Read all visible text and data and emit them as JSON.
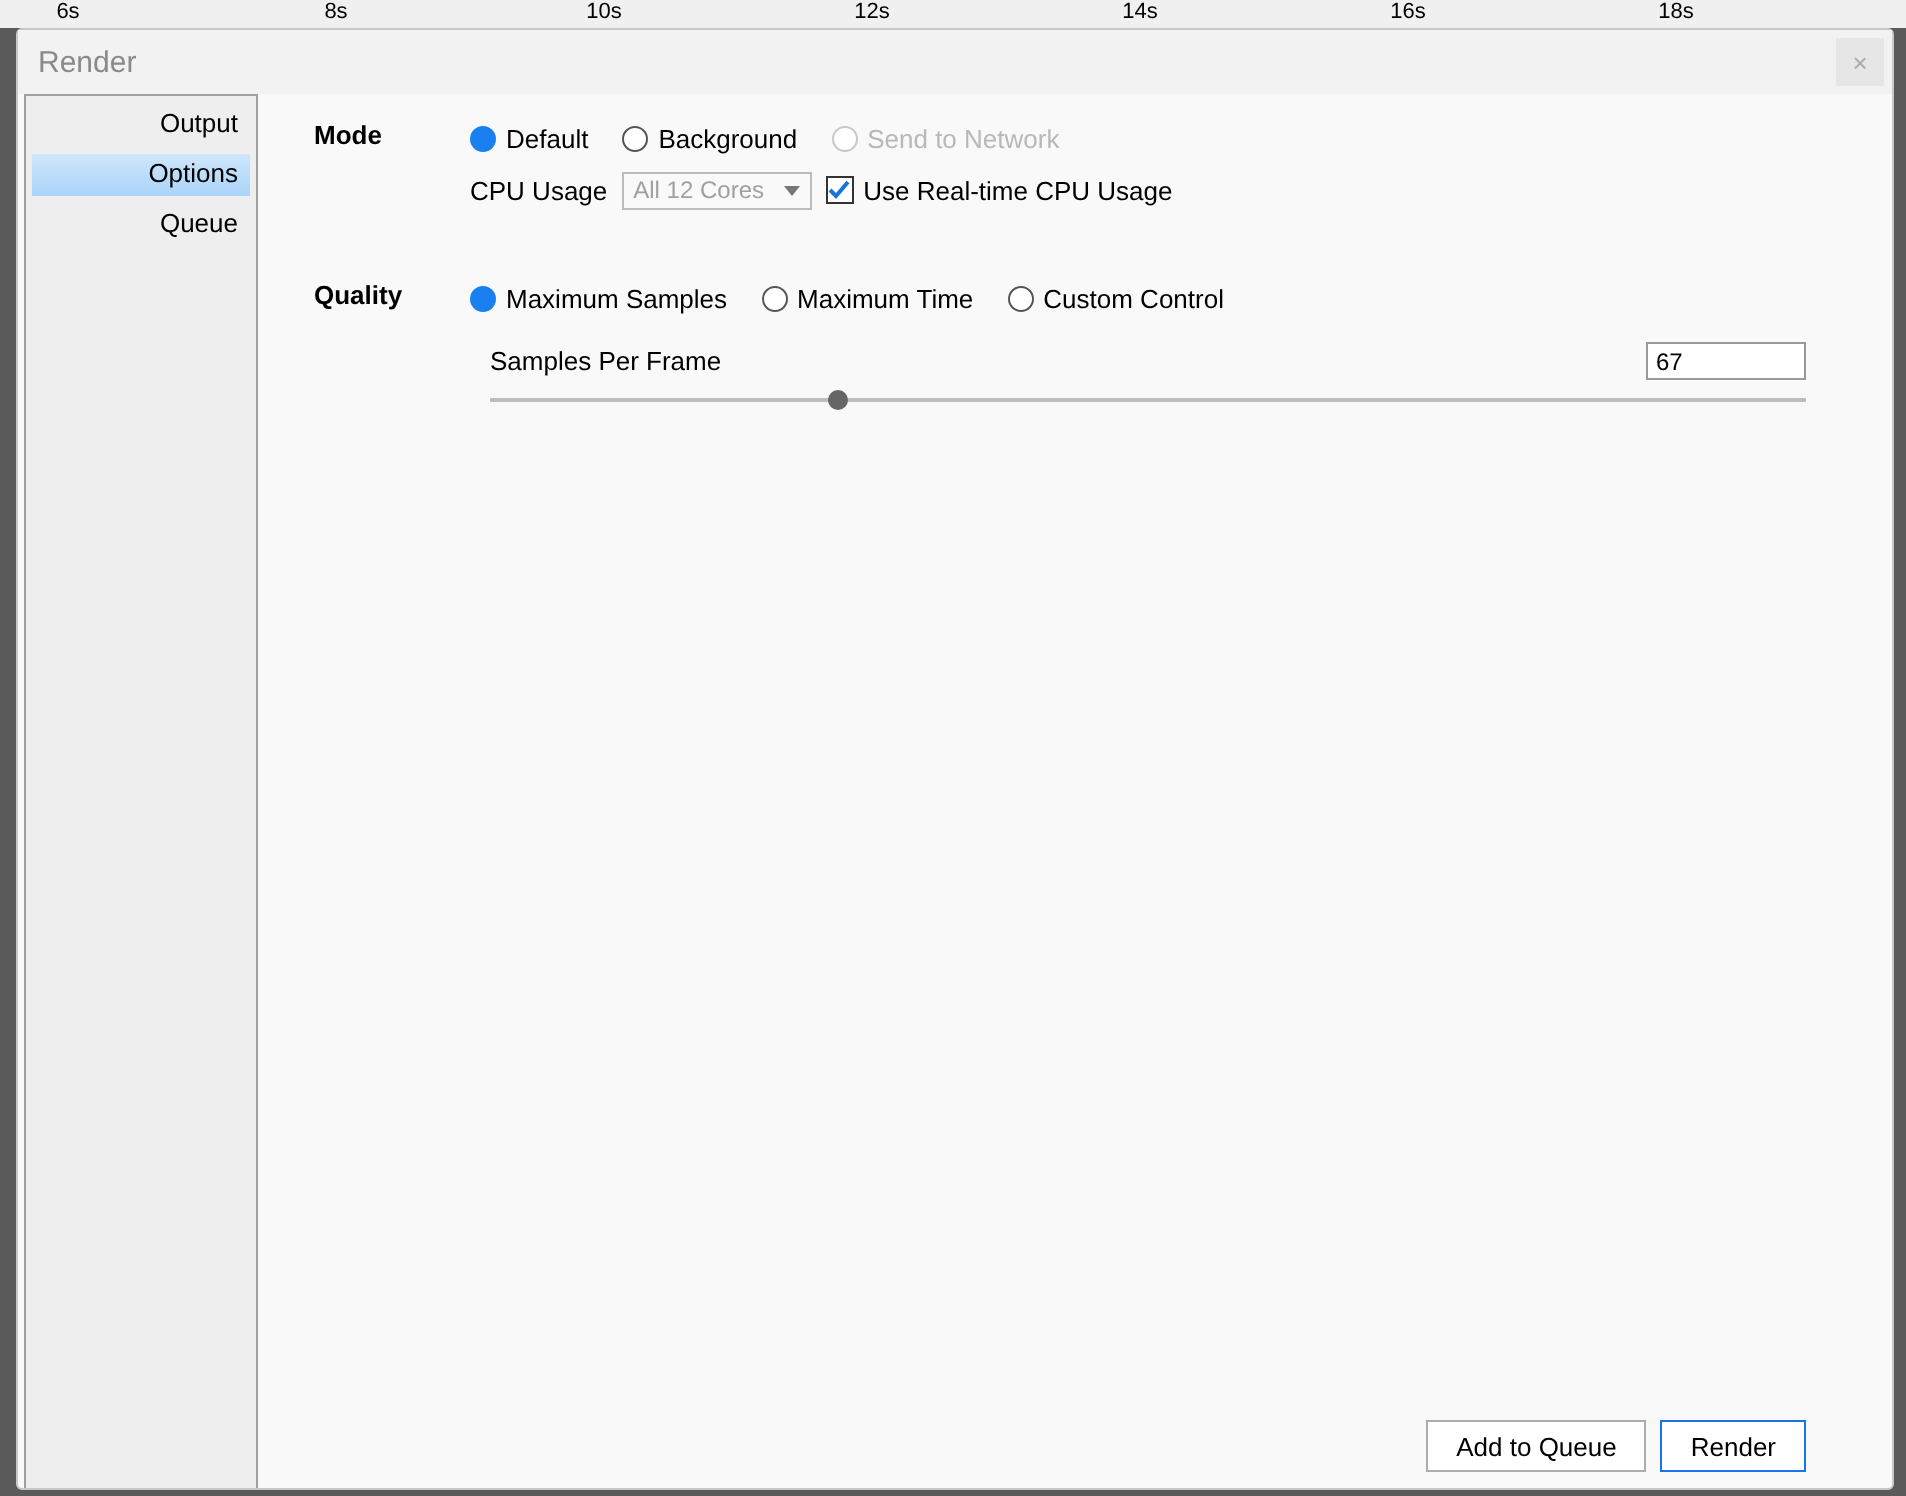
{
  "timeline": {
    "ticks": [
      "6s",
      "8s",
      "10s",
      "12s",
      "14s",
      "16s",
      "18s"
    ]
  },
  "window": {
    "title": "Render",
    "close": "×"
  },
  "sidebar": {
    "items": [
      {
        "label": "Output",
        "selected": false
      },
      {
        "label": "Options",
        "selected": true
      },
      {
        "label": "Queue",
        "selected": false
      }
    ]
  },
  "mode": {
    "label": "Mode",
    "options": [
      {
        "label": "Default",
        "selected": true,
        "disabled": false
      },
      {
        "label": "Background",
        "selected": false,
        "disabled": false
      },
      {
        "label": "Send to Network",
        "selected": false,
        "disabled": true
      }
    ],
    "cpu_usage": {
      "label": "CPU Usage",
      "value": "All 12 Cores",
      "disabled": true
    },
    "realtime": {
      "label": "Use Real-time CPU Usage",
      "checked": true
    }
  },
  "quality": {
    "label": "Quality",
    "options": [
      {
        "label": "Maximum Samples",
        "selected": true
      },
      {
        "label": "Maximum Time",
        "selected": false
      },
      {
        "label": "Custom Control",
        "selected": false
      }
    ],
    "samples": {
      "label": "Samples Per Frame",
      "value": "67",
      "level": 0.264
    }
  },
  "buttons": [
    {
      "label": "Add to Queue",
      "default": false
    },
    {
      "label": "Render",
      "default": true
    }
  ]
}
